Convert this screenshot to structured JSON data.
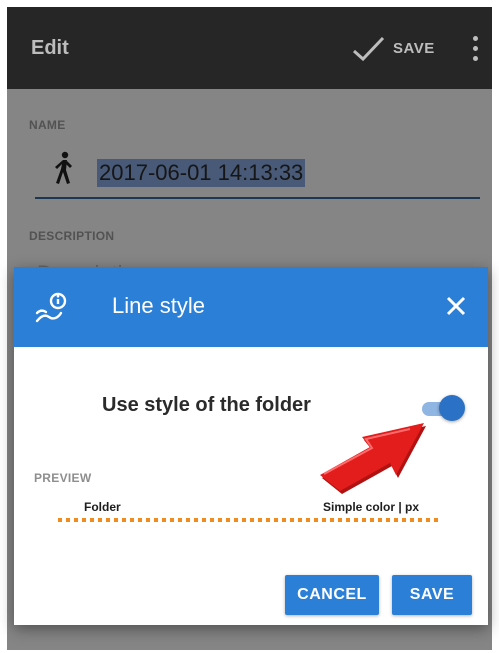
{
  "toolbar": {
    "title": "Edit",
    "save_label": "SAVE",
    "icons": [
      "check-icon",
      "more-vert-icon"
    ]
  },
  "form": {
    "name_label": "NAME",
    "name_value": "2017-06-01 14:13:33",
    "name_icon": "walking-person-icon",
    "description_label": "DESCRIPTION",
    "description_placeholder": "Description"
  },
  "dialog": {
    "title": "Line style",
    "header_icon": "route-info-icon",
    "close_icon": "close-icon",
    "option_label": "Use style of the folder",
    "option_enabled": true,
    "preview_label": "PREVIEW",
    "preview_left": "Folder",
    "preview_right": "Simple color | px",
    "line_color": "#f08c1e",
    "cancel_label": "CANCEL",
    "save_label": "SAVE"
  },
  "colors": {
    "accent": "#2c7fd6",
    "toolbar": "#262626",
    "highlight": "#7d9ccf",
    "arrow": "#e31c1c"
  }
}
